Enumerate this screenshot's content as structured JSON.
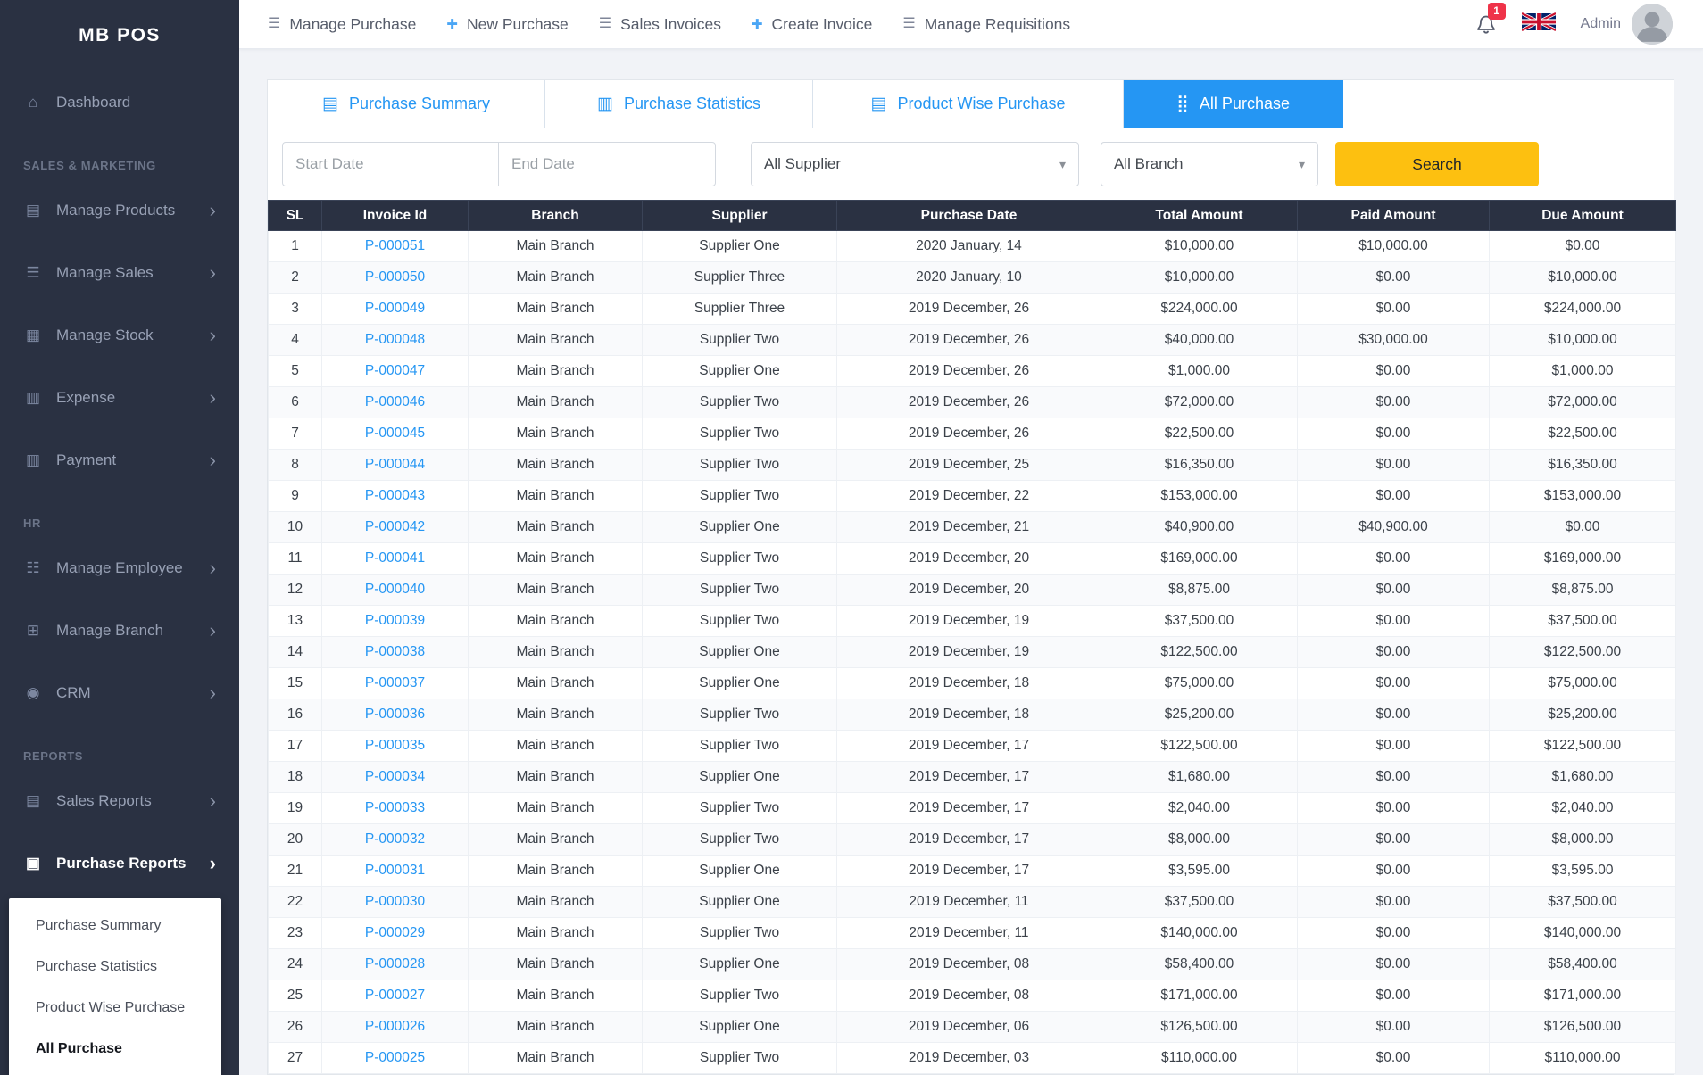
{
  "colors": {
    "sidebar_bg": "#2a3142",
    "accent_blue": "#2596f3",
    "search_button_yellow": "#fdc010",
    "badge_red": "#ef3349",
    "table_header_bg": "#2a3142"
  },
  "sidebar": {
    "logo": "MB POS",
    "menu": [
      {
        "type": "item",
        "label": "Dashboard",
        "icon": "dashboard-icon",
        "chevron": false,
        "active": false
      },
      {
        "type": "section",
        "label": "SALES & MARKETING"
      },
      {
        "type": "item",
        "label": "Manage Products",
        "icon": "products-icon",
        "chevron": true,
        "active": false
      },
      {
        "type": "item",
        "label": "Manage Sales",
        "icon": "sales-icon",
        "chevron": true,
        "active": false
      },
      {
        "type": "item",
        "label": "Manage Stock",
        "icon": "stock-icon",
        "chevron": true,
        "active": false
      },
      {
        "type": "item",
        "label": "Expense",
        "icon": "expense-icon",
        "chevron": true,
        "active": false
      },
      {
        "type": "item",
        "label": "Payment",
        "icon": "payment-icon",
        "chevron": true,
        "active": false
      },
      {
        "type": "section",
        "label": "HR"
      },
      {
        "type": "item",
        "label": "Manage Employee",
        "icon": "employee-icon",
        "chevron": true,
        "active": false
      },
      {
        "type": "item",
        "label": "Manage Branch",
        "icon": "branch-icon",
        "chevron": true,
        "active": false
      },
      {
        "type": "item",
        "label": "CRM",
        "icon": "crm-icon",
        "chevron": true,
        "active": false
      },
      {
        "type": "section",
        "label": "REPORTS"
      },
      {
        "type": "item",
        "label": "Sales Reports",
        "icon": "sales-reports-icon",
        "chevron": true,
        "active": false
      },
      {
        "type": "item",
        "label": "Purchase Reports",
        "icon": "purchase-reports-icon",
        "chevron": true,
        "active": true
      },
      {
        "type": "submenu",
        "items": [
          {
            "label": "Purchase Summary",
            "active": false
          },
          {
            "label": "Purchase Statistics",
            "active": false
          },
          {
            "label": "Product Wise Purchase",
            "active": false
          },
          {
            "label": "All Purchase",
            "active": true
          }
        ]
      }
    ]
  },
  "header": {
    "nav": [
      {
        "label": "Manage Purchase",
        "icon": "list-icon"
      },
      {
        "label": "New Purchase",
        "icon": "plus-icon"
      },
      {
        "label": "Sales Invoices",
        "icon": "list-icon"
      },
      {
        "label": "Create Invoice",
        "icon": "plus-icon"
      },
      {
        "label": "Manage Requisitions",
        "icon": "list-icon"
      }
    ],
    "notification_count": "1",
    "user": "Admin"
  },
  "tabs": [
    {
      "label": "Purchase Summary",
      "icon": "card-icon",
      "active": false
    },
    {
      "label": "Purchase Statistics",
      "icon": "bar-chart-icon",
      "active": false
    },
    {
      "label": "Product Wise Purchase",
      "icon": "card-icon",
      "active": false
    },
    {
      "label": "All Purchase",
      "icon": "grid-icon",
      "active": true
    }
  ],
  "filters": {
    "start_date_placeholder": "Start Date",
    "end_date_placeholder": "End Date",
    "supplier_value": "All Supplier",
    "branch_value": "All Branch",
    "search_label": "Search"
  },
  "table": {
    "headers": [
      "SL",
      "Invoice Id",
      "Branch",
      "Supplier",
      "Purchase Date",
      "Total Amount",
      "Paid Amount",
      "Due Amount"
    ],
    "keys": [
      "sl",
      "invoice-id",
      "branch",
      "supplier",
      "purchase-date",
      "total-amount",
      "paid-amount",
      "due-amount"
    ],
    "rows": [
      [
        "1",
        "P-000051",
        "Main Branch",
        "Supplier One",
        "2020 January, 14",
        "$10,000.00",
        "$10,000.00",
        "$0.00"
      ],
      [
        "2",
        "P-000050",
        "Main Branch",
        "Supplier Three",
        "2020 January, 10",
        "$10,000.00",
        "$0.00",
        "$10,000.00"
      ],
      [
        "3",
        "P-000049",
        "Main Branch",
        "Supplier Three",
        "2019 December, 26",
        "$224,000.00",
        "$0.00",
        "$224,000.00"
      ],
      [
        "4",
        "P-000048",
        "Main Branch",
        "Supplier Two",
        "2019 December, 26",
        "$40,000.00",
        "$30,000.00",
        "$10,000.00"
      ],
      [
        "5",
        "P-000047",
        "Main Branch",
        "Supplier One",
        "2019 December, 26",
        "$1,000.00",
        "$0.00",
        "$1,000.00"
      ],
      [
        "6",
        "P-000046",
        "Main Branch",
        "Supplier Two",
        "2019 December, 26",
        "$72,000.00",
        "$0.00",
        "$72,000.00"
      ],
      [
        "7",
        "P-000045",
        "Main Branch",
        "Supplier Two",
        "2019 December, 26",
        "$22,500.00",
        "$0.00",
        "$22,500.00"
      ],
      [
        "8",
        "P-000044",
        "Main Branch",
        "Supplier Two",
        "2019 December, 25",
        "$16,350.00",
        "$0.00",
        "$16,350.00"
      ],
      [
        "9",
        "P-000043",
        "Main Branch",
        "Supplier Two",
        "2019 December, 22",
        "$153,000.00",
        "$0.00",
        "$153,000.00"
      ],
      [
        "10",
        "P-000042",
        "Main Branch",
        "Supplier One",
        "2019 December, 21",
        "$40,900.00",
        "$40,900.00",
        "$0.00"
      ],
      [
        "11",
        "P-000041",
        "Main Branch",
        "Supplier Two",
        "2019 December, 20",
        "$169,000.00",
        "$0.00",
        "$169,000.00"
      ],
      [
        "12",
        "P-000040",
        "Main Branch",
        "Supplier Two",
        "2019 December, 20",
        "$8,875.00",
        "$0.00",
        "$8,875.00"
      ],
      [
        "13",
        "P-000039",
        "Main Branch",
        "Supplier Two",
        "2019 December, 19",
        "$37,500.00",
        "$0.00",
        "$37,500.00"
      ],
      [
        "14",
        "P-000038",
        "Main Branch",
        "Supplier One",
        "2019 December, 19",
        "$122,500.00",
        "$0.00",
        "$122,500.00"
      ],
      [
        "15",
        "P-000037",
        "Main Branch",
        "Supplier One",
        "2019 December, 18",
        "$75,000.00",
        "$0.00",
        "$75,000.00"
      ],
      [
        "16",
        "P-000036",
        "Main Branch",
        "Supplier Two",
        "2019 December, 18",
        "$25,200.00",
        "$0.00",
        "$25,200.00"
      ],
      [
        "17",
        "P-000035",
        "Main Branch",
        "Supplier Two",
        "2019 December, 17",
        "$122,500.00",
        "$0.00",
        "$122,500.00"
      ],
      [
        "18",
        "P-000034",
        "Main Branch",
        "Supplier One",
        "2019 December, 17",
        "$1,680.00",
        "$0.00",
        "$1,680.00"
      ],
      [
        "19",
        "P-000033",
        "Main Branch",
        "Supplier Two",
        "2019 December, 17",
        "$2,040.00",
        "$0.00",
        "$2,040.00"
      ],
      [
        "20",
        "P-000032",
        "Main Branch",
        "Supplier Two",
        "2019 December, 17",
        "$8,000.00",
        "$0.00",
        "$8,000.00"
      ],
      [
        "21",
        "P-000031",
        "Main Branch",
        "Supplier One",
        "2019 December, 17",
        "$3,595.00",
        "$0.00",
        "$3,595.00"
      ],
      [
        "22",
        "P-000030",
        "Main Branch",
        "Supplier One",
        "2019 December, 11",
        "$37,500.00",
        "$0.00",
        "$37,500.00"
      ],
      [
        "23",
        "P-000029",
        "Main Branch",
        "Supplier Two",
        "2019 December, 11",
        "$140,000.00",
        "$0.00",
        "$140,000.00"
      ],
      [
        "24",
        "P-000028",
        "Main Branch",
        "Supplier One",
        "2019 December, 08",
        "$58,400.00",
        "$0.00",
        "$58,400.00"
      ],
      [
        "25",
        "P-000027",
        "Main Branch",
        "Supplier Two",
        "2019 December, 08",
        "$171,000.00",
        "$0.00",
        "$171,000.00"
      ],
      [
        "26",
        "P-000026",
        "Main Branch",
        "Supplier One",
        "2019 December, 06",
        "$126,500.00",
        "$0.00",
        "$126,500.00"
      ],
      [
        "27",
        "P-000025",
        "Main Branch",
        "Supplier Two",
        "2019 December, 03",
        "$110,000.00",
        "$0.00",
        "$110,000.00"
      ]
    ]
  }
}
